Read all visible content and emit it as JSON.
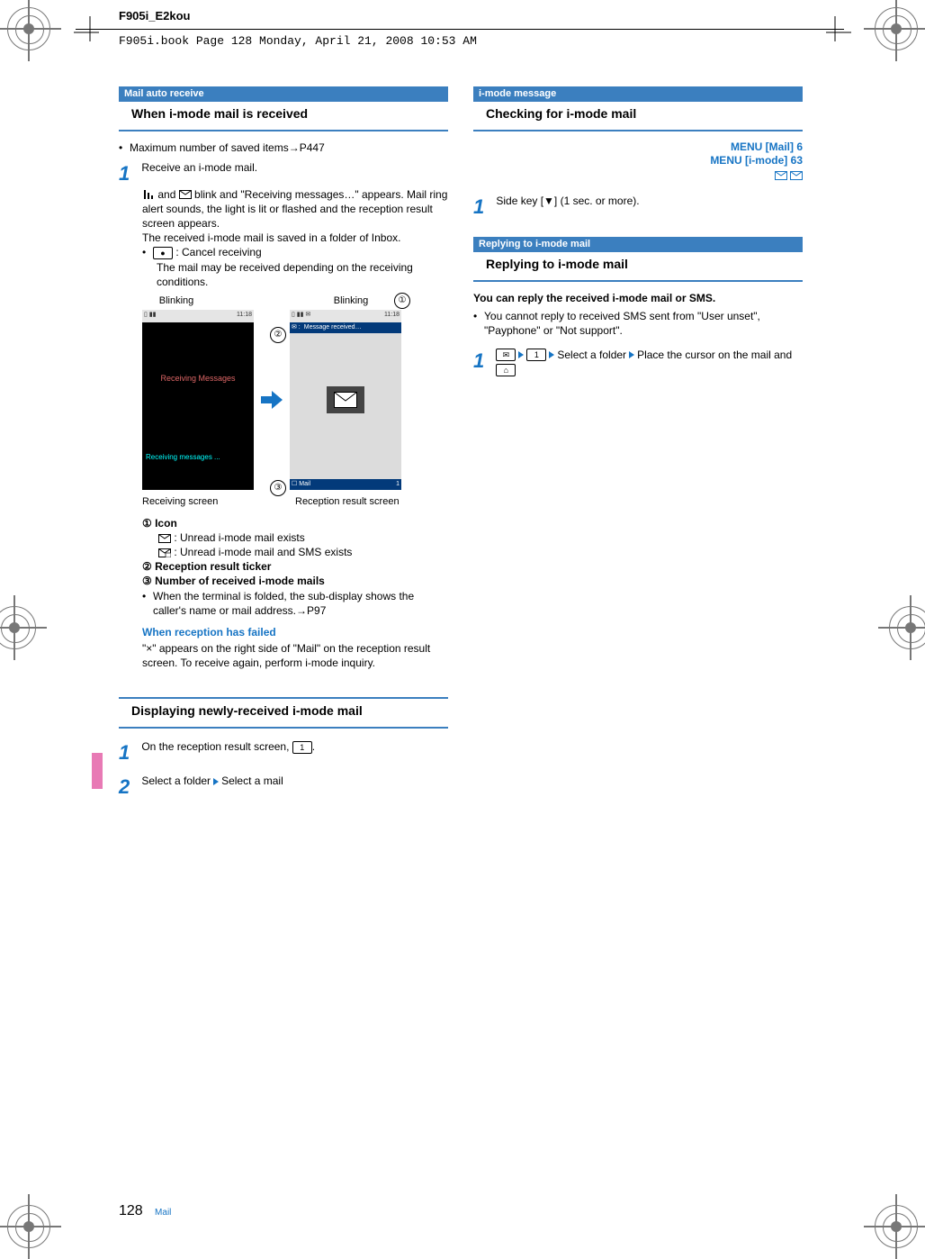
{
  "doc_header": "F905i_E2kou",
  "stamp": "F905i.book  Page 128  Monday, April 21, 2008  10:53 AM",
  "left": {
    "tag1": "Mail auto receive",
    "title1": "When i-mode mail is received",
    "bullet1": "Maximum number of saved items→P447",
    "step1_num": "1",
    "step1_text": "Receive an i-mode mail.",
    "step1_para1a": " and ",
    "step1_para1b": " blink and \"Receiving messages…\" appears. Mail ring alert sounds, the light is lit or flashed and the reception result screen appears.",
    "step1_para2": "The received i-mode mail is saved in a folder of Inbox.",
    "cancel_label": " : Cancel receiving",
    "cancel_key": "●",
    "cancel_note": "The mail may be received depending on the receiving conditions.",
    "blink_l": "Blinking",
    "blink_r": "Blinking",
    "callout1": "①",
    "callout2": "②",
    "callout3": "③",
    "ph_time_l": "11:18",
    "ph_time_r": "11:18",
    "ph_ticker": "Message received…",
    "ph_recv_mid": "Receiving Messages",
    "ph_recv_bot": "Receiving messages ...",
    "ph_foot_mail": "Mail",
    "ph_foot_count": "1",
    "cap_l": "Receiving screen",
    "cap_r": "Reception result screen",
    "legend1_label": " Icon",
    "legend1_a": " : Unread i-mode mail exists",
    "legend1_b": " : Unread i-mode mail and SMS exists",
    "legend2": " Reception result ticker",
    "legend3": " Number of received i-mode mails",
    "legend_bullet": "When the terminal is folded, the sub-display shows the caller's name or mail address.→P97",
    "fail_head": "When reception has failed",
    "fail_body": "\"×\" appears on the right side of \"Mail\" on the reception result screen. To receive again, perform i-mode inquiry.",
    "title2": "Displaying newly-received i-mode mail",
    "step2_1_num": "1",
    "step2_1_text": "On the reception result screen, ",
    "step2_1_key": "1",
    "step2_1_end": ".",
    "step2_2_num": "2",
    "step2_2_a": "Select a folder",
    "step2_2_b": "Select a mail"
  },
  "right": {
    "tag1": "i-mode message",
    "title1": "Checking for i-mode mail",
    "menu1": "MENU [Mail] 6",
    "menu2": "MENU [i-mode] 63",
    "step1_num": "1",
    "step1_text": "Side key [▼] (1 sec. or more).",
    "tag2": "Replying to i-mode mail",
    "title2": "Replying to i-mode mail",
    "intro_bold": "You can reply the received i-mode mail or SMS.",
    "intro_bullet": "You cannot reply to received SMS sent from \"User unset\", \"Payphone\" or \"Not support\".",
    "step2_num": "1",
    "step2_key1": "✉",
    "step2_key2": "1",
    "step2_a": "Select a folder",
    "step2_b": "Place the cursor on the mail and ",
    "step2_key3": "⌂"
  },
  "footer": {
    "page": "128",
    "section": "Mail"
  }
}
